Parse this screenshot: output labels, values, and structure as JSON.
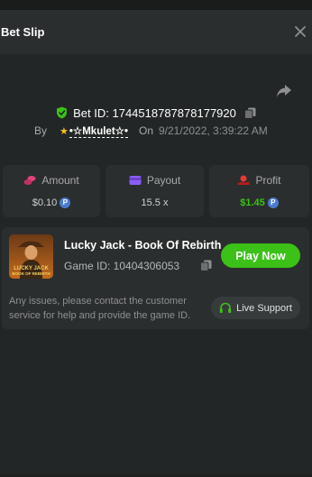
{
  "header": {
    "title": "Bet Slip"
  },
  "bet": {
    "id_label": "Bet ID: 1744518787878177920",
    "by_label": "By",
    "user": "•☆Mkulet☆•",
    "on_label": "On",
    "date": "9/21/2022, 3:39:22 AM"
  },
  "stats": {
    "amount": {
      "label": "Amount",
      "value": "$0.10"
    },
    "payout": {
      "label": "Payout",
      "value": "15.5 x"
    },
    "profit": {
      "label": "Profit",
      "value": "$1.45"
    }
  },
  "coin_symbol": "P",
  "game": {
    "name": "Lucky Jack - Book Of Rebirth",
    "id_label": "Game ID: 10404306053",
    "thumb_text_1": "LUCKY JACK",
    "thumb_text_2": "BOOK OF REBIRTH",
    "play_label": "Play Now",
    "help_text": "Any issues, please contact the customer service for help and provide the game ID.",
    "support_label": "Live Support"
  },
  "colors": {
    "accent_green": "#3bc117",
    "amount_icon": "#e0437a",
    "payout_icon": "#8b5cf6",
    "profit_icon": "#e53935",
    "coin": "#4a7bd0",
    "verified_shield": "#3bc117"
  },
  "icons": {
    "close": "close-icon",
    "share": "share-icon",
    "verified": "shield-check-icon",
    "copy": "copy-icon",
    "amount": "coins-icon",
    "payout": "wallet-icon",
    "profit": "money-hand-icon",
    "support": "headset-icon"
  }
}
